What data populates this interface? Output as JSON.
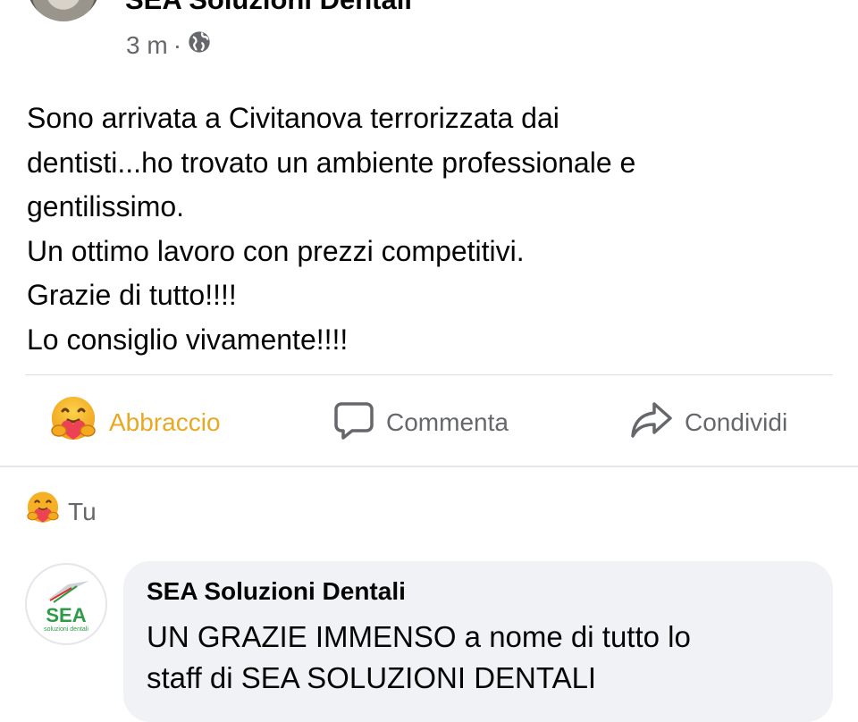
{
  "post": {
    "author": "SEA Soluzioni Dentali",
    "time": "3 m",
    "separator": "·",
    "privacy_icon": "globe-icon",
    "text_lines": [
      "Sono arrivata a Civitanova terrorizzata dai",
      "dentisti...ho trovato un ambiente professionale e",
      "gentilissimo.",
      "Un ottimo lavoro con prezzi competitivi.",
      "Grazie di tutto!!!!",
      "Lo consiglio vivamente!!!!"
    ]
  },
  "actions": {
    "react_label": "Abbraccio",
    "react_icon": "care-emoji-icon",
    "comment_label": "Commenta",
    "comment_icon": "comment-icon",
    "share_label": "Condividi",
    "share_icon": "share-icon"
  },
  "reactions": {
    "icon": "care-emoji-icon",
    "label": "Tu"
  },
  "comment": {
    "author": "SEA Soluzioni Dentali",
    "avatar_logo_text": "SEA",
    "avatar_logo_subtext": "soluzioni dentali",
    "text_lines": [
      "UN GRAZIE IMMENSO a nome di tutto lo",
      "staff di SEA SOLUZIONI DENTALI"
    ]
  },
  "colors": {
    "text": "#050505",
    "secondary_text": "#65676b",
    "care_reaction": "#e9a821",
    "comment_bubble": "#f0f2f5",
    "logo_green": "#2e9b46"
  }
}
